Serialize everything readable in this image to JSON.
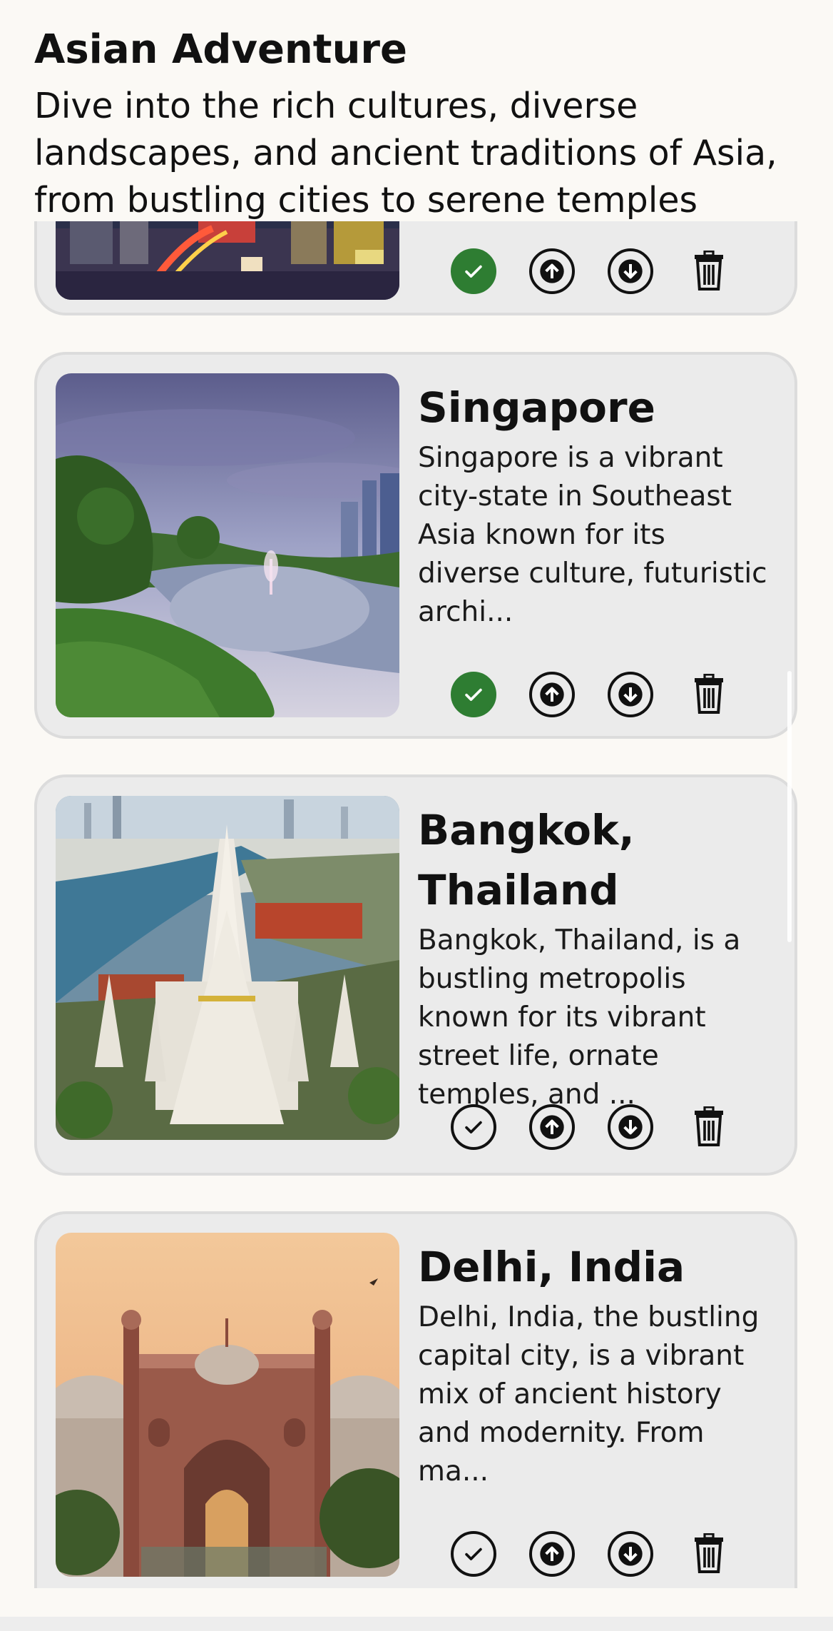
{
  "header": {
    "title": "Asian Adventure",
    "subtitle": "Dive into the rich cultures, diverse landscapes, and ancient traditions of Asia, from bustling cities to serene temples"
  },
  "cards": [
    {
      "title": "",
      "description": "",
      "completed": true,
      "image": "tokyo-city-photo"
    },
    {
      "title": "Singapore",
      "description": "Singapore is a vibrant city-state in Southeast Asia known for its diverse culture, futuristic archi...",
      "completed": true,
      "image": "singapore-park-photo"
    },
    {
      "title": "Bangkok, Thailand",
      "description": "Bangkok, Thailand, is a bustling metropolis known for its vibrant street life, ornate temples, and ...",
      "completed": false,
      "image": "bangkok-temple-photo"
    },
    {
      "title": "Delhi, India",
      "description": "Delhi, India, the bustling capital city, is a vibrant mix of ancient history and modernity. From ma...",
      "completed": false,
      "image": "delhi-gate-photo"
    }
  ],
  "icons": {
    "complete": "check-circle-icon",
    "move_up": "arrow-up-circle-icon",
    "move_down": "arrow-down-circle-icon",
    "delete": "trash-icon"
  },
  "colors": {
    "background": "#fbf9f5",
    "card": "#ebebeb",
    "done": "#2e7d32"
  }
}
